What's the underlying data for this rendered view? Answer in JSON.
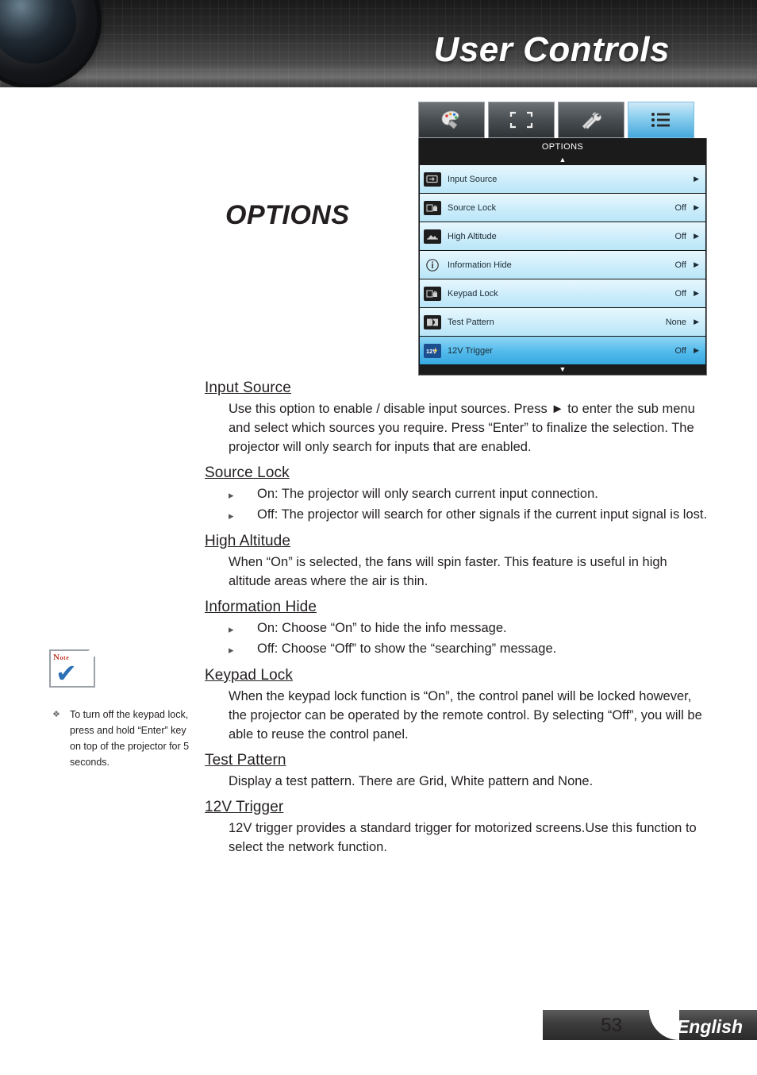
{
  "header": {
    "title": "User Controls",
    "logo_icon": "projector-lens-icon"
  },
  "page_heading": "OPTIONS",
  "osd": {
    "title": "OPTIONS",
    "scroll_up_icon": "triangle-up-icon",
    "scroll_down_icon": "triangle-down-icon",
    "tabs": [
      {
        "name": "image-tab",
        "icon": "palette-icon",
        "active": false
      },
      {
        "name": "display-tab",
        "icon": "screen-frame-icon",
        "active": false
      },
      {
        "name": "setup-tab",
        "icon": "wrench-screwdriver-icon",
        "active": false
      },
      {
        "name": "options-tab",
        "icon": "list-bullets-icon",
        "active": true
      }
    ],
    "rows": [
      {
        "icon": "input-source-icon",
        "label": "Input Source",
        "value": "",
        "chevron": "▶",
        "selected": false
      },
      {
        "icon": "source-lock-icon",
        "label": "Source Lock",
        "value": "Off",
        "chevron": "▶",
        "selected": false
      },
      {
        "icon": "high-altitude-icon",
        "label": "High Altitude",
        "value": "Off",
        "chevron": "▶",
        "selected": false
      },
      {
        "icon": "information-hide-icon",
        "label": "Information Hide",
        "value": "Off",
        "chevron": "▶",
        "selected": false
      },
      {
        "icon": "keypad-lock-icon",
        "label": "Keypad Lock",
        "value": "Off",
        "chevron": "▶",
        "selected": false
      },
      {
        "icon": "test-pattern-icon",
        "label": "Test Pattern",
        "value": "None",
        "chevron": "▶",
        "selected": false
      },
      {
        "icon": "12v-trigger-icon",
        "label": "12V Trigger",
        "value": "Off",
        "chevron": "▶",
        "selected": true
      }
    ]
  },
  "sections": [
    {
      "title": "Input Source",
      "body": "Use this option to enable / disable input sources. Press ► to enter the sub menu and select which sources you require. Press “Enter” to finalize the selection. The projector will only search for inputs that are enabled."
    },
    {
      "title": "Source Lock",
      "bullets": [
        "On: The projector will only search current input connection.",
        "Off: The projector will search for other signals if the current input signal is lost."
      ]
    },
    {
      "title": "High Altitude",
      "body": "When “On” is selected, the fans will spin faster. This feature is useful in high altitude areas where the air is thin."
    },
    {
      "title": "Information Hide",
      "bullets": [
        "On: Choose “On” to hide the info message.",
        "Off: Choose “Off” to show the “searching” message."
      ]
    },
    {
      "title": "Keypad Lock",
      "body": "When the keypad lock function is “On”, the control panel will be locked however, the projector can be operated by the remote control. By selecting “Off”, you will be able to reuse the control panel."
    },
    {
      "title": "Test Pattern",
      "body": "Display a test pattern. There are Grid, White pattern and None."
    },
    {
      "title": "12V Trigger",
      "body": "12V trigger provides a standard trigger for motorized screens.Use this function to select the network function."
    }
  ],
  "note": {
    "badge_word": "Note",
    "badge_word_small": "ote",
    "check_icon": "check-mark-icon",
    "bullet_icon": "diamond-bullet-icon",
    "text": "To turn off the keypad lock, press and hold “Enter” key on top of the projector for 5 seconds."
  },
  "footer": {
    "page_number": "53",
    "language": "English"
  }
}
